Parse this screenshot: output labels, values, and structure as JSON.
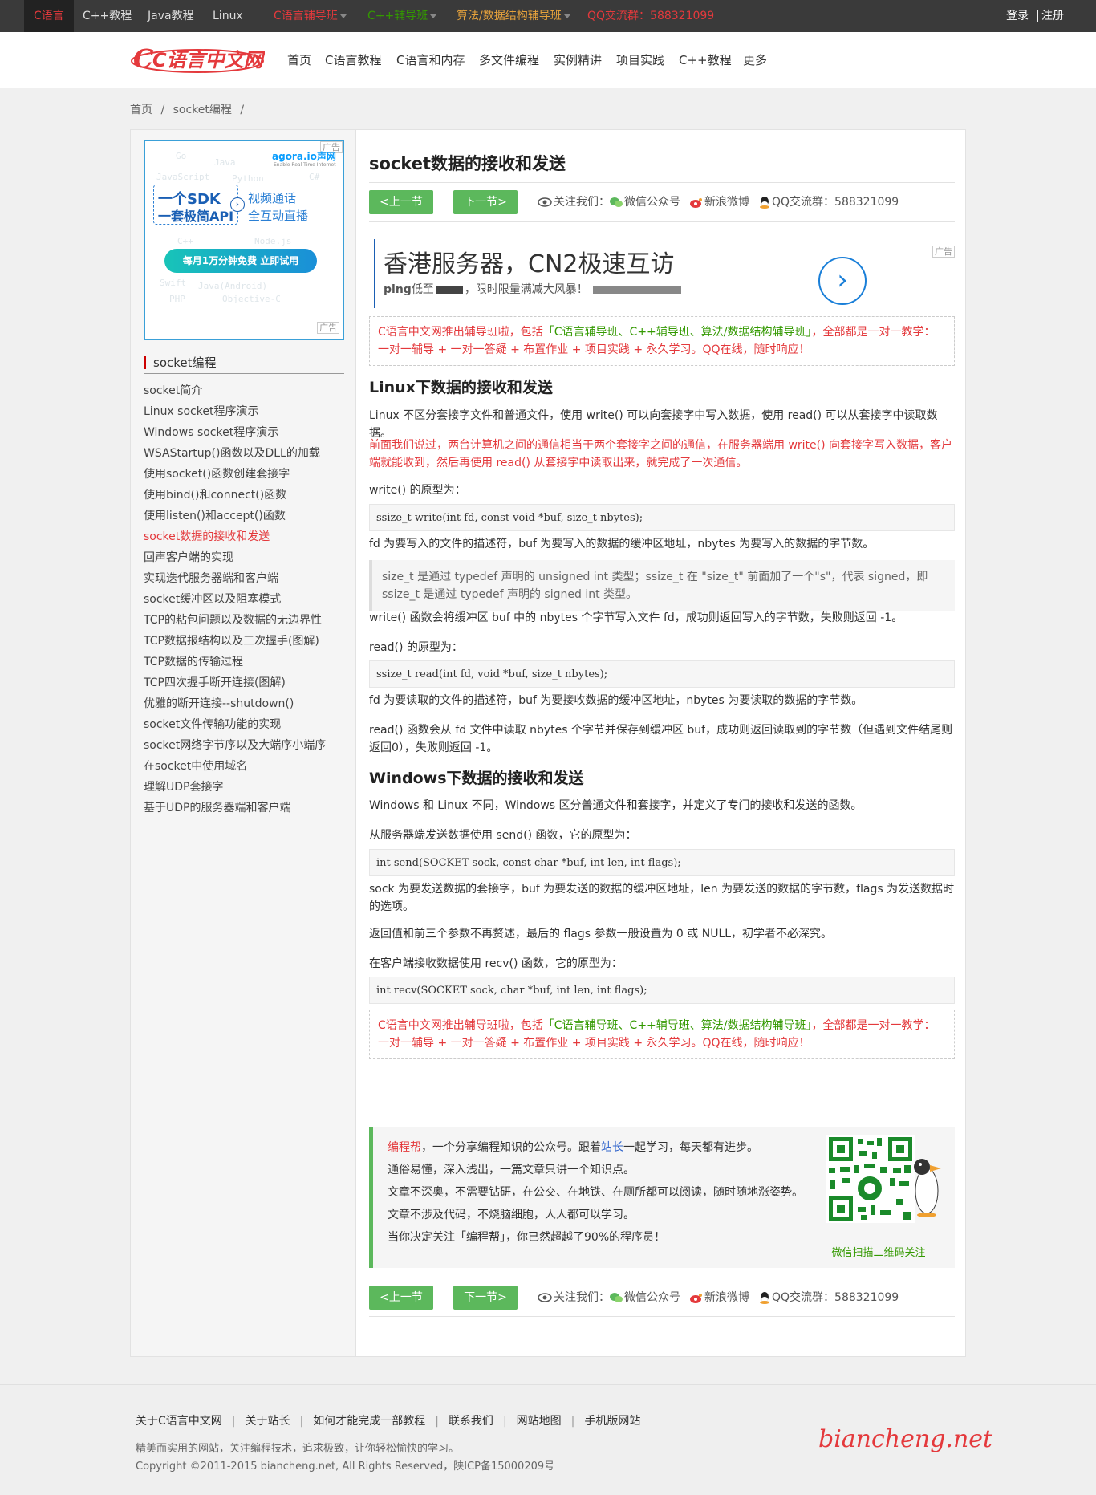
{
  "topbar": {
    "items": [
      "C语言",
      "C++教程",
      "Java教程",
      "Linux",
      "C语言辅导班",
      "C++辅导班",
      "算法/数据结构辅导班",
      "QQ交流群：588321099"
    ],
    "login": "登录",
    "register": "注册",
    "sep": "|"
  },
  "header": {
    "logo_text": "C语言中文网",
    "nav": [
      "首页",
      "C语言教程",
      "C语言和内存",
      "多文件编程",
      "实例精讲",
      "项目实践",
      "C++教程",
      "更多"
    ]
  },
  "breadcrumb": {
    "home": "首页",
    "section": "socket编程",
    "sep": "/"
  },
  "sidebar": {
    "ad": {
      "brand": "agora.io声网",
      "brand_sub": "Enable Real Time Internet",
      "line1a": "一个SDK",
      "line1b": "一套极简API",
      "line2a": "视频通话",
      "line2b": "全互动直播",
      "cta": "每月1万分钟免费  立即试用",
      "ad_label": "广告",
      "bg_words": [
        "Go",
        "Java",
        "JavaScript",
        "Python",
        "C#",
        "C++",
        "Node.js",
        "Swift",
        "Java(Android)",
        "PHP",
        "Objective-C"
      ]
    },
    "title": "socket编程",
    "items": [
      "socket简介",
      "Linux socket程序演示",
      "Windows socket程序演示",
      "WSAStartup()函数以及DLL的加载",
      "使用socket()函数创建套接字",
      "使用bind()和connect()函数",
      "使用listen()和accept()函数",
      "socket数据的接收和发送",
      "回声客户端的实现",
      "实现迭代服务器端和客户端",
      "socket缓冲区以及阻塞模式",
      "TCP的粘包问题以及数据的无边界性",
      "TCP数据报结构以及三次握手(图解)",
      "TCP数据的传输过程",
      "TCP四次握手断开连接(图解)",
      "优雅的断开连接--shutdown()",
      "socket文件传输功能的实现",
      "socket网络字节序以及大端序小端序",
      "在socket中使用域名",
      "理解UDP套接字",
      "基于UDP的服务器端和客户端"
    ],
    "active_index": 7
  },
  "article": {
    "title": "socket数据的接收和发送",
    "prev_label": "<上一节",
    "next_label": "下一节>",
    "follow_label": "关注我们：",
    "wechat": "微信公众号",
    "weibo": "新浪微博",
    "qq": "QQ交流群：588321099",
    "banner_ad": {
      "headline": "香港服务器，CN2极速互访",
      "sub_prefix": "ping",
      "sub": "低至",
      "sub2": "，限时限量满减大风暴！",
      "ad_label": "广告"
    },
    "notice": {
      "p1": "C语言中文网推出辅导班啦，包括",
      "p1_green": "「C语言辅导班、C++辅导班、算法/数据结构辅导班」",
      "p1_end": "，全部都是一对一教学：",
      "p2": "一对一辅导 + 一对一答疑 + 布置作业 + 项目实践 + 永久学习。QQ在线，随时响应！"
    },
    "sec1": "Linux下数据的接收和发送",
    "p_linux1": "Linux 不区分套接字文件和普通文件，使用 write() 可以向套接字中写入数据，使用 read() 可以从套接字中读取数据。",
    "p_linux2": "前面我们说过，两台计算机之间的通信相当于两个套接字之间的通信，在服务器端用 write() 向套接字写入数据，客户端就能收到，然后再使用 read() 从套接字中读取出来，就完成了一次通信。",
    "write_proto_label": "write() 的原型为：",
    "write_code": "ssize_t write(int fd, const void *buf, size_t nbytes);",
    "write_desc": "fd 为要写入的文件的描述符，buf 为要写入的数据的缓冲区地址，nbytes 为要写入的数据的字节数。",
    "quote": "size_t 是通过 typedef 声明的 unsigned int 类型；ssize_t 在 \"size_t\" 前面加了一个\"s\"，代表 signed，即 ssize_t 是通过 typedef 声明的 signed int 类型。",
    "write_ret": "write() 函数会将缓冲区 buf 中的 nbytes 个字节写入文件 fd，成功则返回写入的字节数，失败则返回 -1。",
    "read_proto_label": "read() 的原型为：",
    "read_code": "ssize_t read(int fd, void *buf, size_t nbytes);",
    "read_desc": "fd 为要读取的文件的描述符，buf 为要接收数据的缓冲区地址，nbytes 为要读取的数据的字节数。",
    "read_ret": "read() 函数会从 fd 文件中读取 nbytes 个字节并保存到缓冲区 buf，成功则返回读取到的字节数（但遇到文件结尾则返回0），失败则返回 -1。",
    "sec2": "Windows下数据的接收和发送",
    "p_win1": "Windows 和 Linux 不同，Windows 区分普通文件和套接字，并定义了专门的接收和发送的函数。",
    "send_label": "从服务器端发送数据使用 send() 函数，它的原型为：",
    "send_code": "int send(SOCKET sock, const char *buf, int len, int flags);",
    "send_desc": "sock 为要发送数据的套接字，buf 为要发送的数据的缓冲区地址，len 为要发送的数据的字节数，flags 为发送数据时的选项。",
    "send_ret": "返回值和前三个参数不再赘述，最后的 flags 参数一般设置为 0 或 NULL，初学者不必深究。",
    "recv_label": "在客户端接收数据使用 recv() 函数，它的原型为：",
    "recv_code": "int recv(SOCKET sock, char *buf, int len, int flags);",
    "promo": {
      "l1_red": "编程帮",
      "l1_mid": "，一个分享编程知识的公众号。跟着",
      "l1_blue": "站长",
      "l1_end": "一起学习，每天都有进步。",
      "l2": "通俗易懂，深入浅出，一篇文章只讲一个知识点。",
      "l3": "文章不深奥，不需要钻研，在公交、在地铁、在厕所都可以阅读，随时随地涨姿势。",
      "l4": "文章不涉及代码，不烧脑细胞，人人都可以学习。",
      "l5": "当你决定关注「编程帮」，你已然超越了90%的程序员！",
      "qr_caption": "微信扫描二维码关注"
    }
  },
  "footer": {
    "links": [
      "关于C语言中文网",
      "关于站长",
      "如何才能完成一部教程",
      "联系我们",
      "网站地图",
      "手机版网站"
    ],
    "sep": "|",
    "line1": "精美而实用的网站，关注编程技术，追求极致，让你轻松愉快的学习。",
    "line2": "Copyright ©2011-2015 biancheng.net, All Rights Reserved，陕ICP备15000209号",
    "logo": "biancheng.net"
  },
  "colors": {
    "accent_red": "#e4393c",
    "green": "#5cb85c",
    "topbar_bg": "#3a3a3a",
    "link_green": "#339900"
  }
}
